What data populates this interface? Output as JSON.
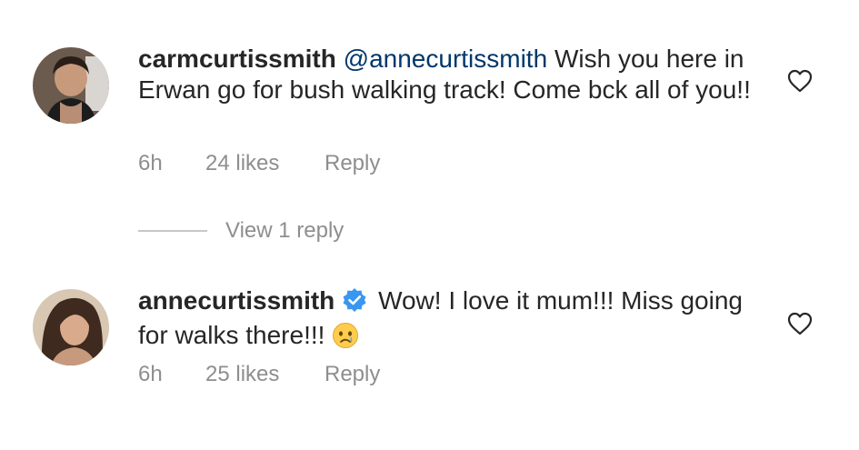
{
  "comments": [
    {
      "username": "carmcurtissmith",
      "mention": "@annecurtissmith",
      "text": "Wish you here in Erwan go for bush walking track! Come bck all of you!!",
      "time": "6h",
      "likes": "24 likes",
      "reply_label": "Reply",
      "verified": false,
      "avatar_icon": "profile-photo"
    },
    {
      "username": "annecurtissmith",
      "text": "Wow! I love it mum!!! Miss going for walks there!!!",
      "time": "6h",
      "likes": "25 likes",
      "reply_label": "Reply",
      "verified": true,
      "emoji": "crying-face-emoji",
      "avatar_icon": "profile-photo"
    }
  ],
  "view_replies_label": "View 1 reply",
  "colors": {
    "text": "#262626",
    "meta": "#8e8e8e",
    "mention": "#00376b",
    "verified": "#3897f0"
  },
  "icons": [
    "heart-outline-icon",
    "verified-badge-icon",
    "crying-face-emoji"
  ]
}
